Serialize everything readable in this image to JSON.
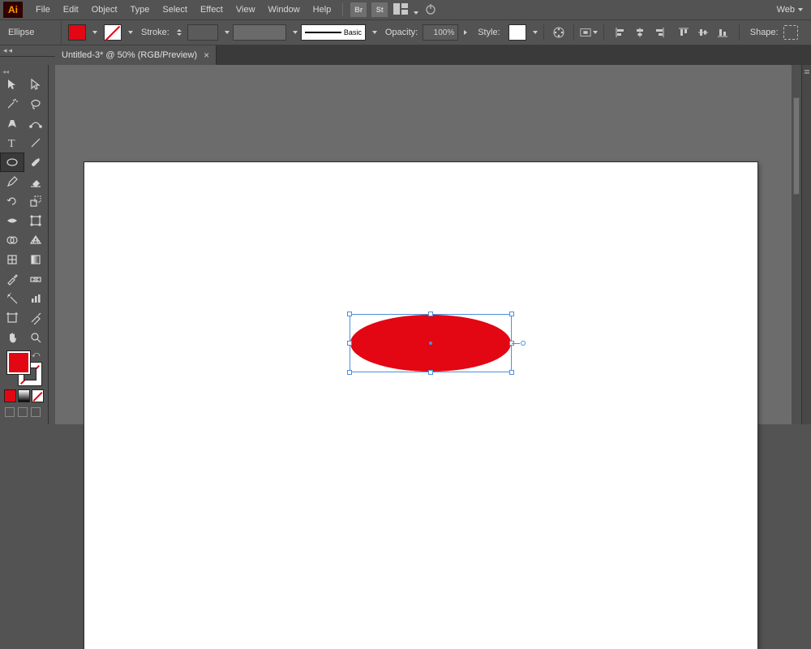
{
  "app_logo": "Ai",
  "menus": [
    "File",
    "Edit",
    "Object",
    "Type",
    "Select",
    "Effect",
    "View",
    "Window",
    "Help"
  ],
  "bridge_label": "Br",
  "stock_label": "St",
  "workspace_name": "Web",
  "control": {
    "selection_label": "Ellipse",
    "fill_color": "#e30613",
    "stroke_label": "Stroke:",
    "stroke_weight": "",
    "profile_label": "Basic",
    "opacity_label": "Opacity:",
    "opacity_value": "100%",
    "style_label": "Style:",
    "shape_label": "Shape:"
  },
  "document": {
    "tab_title": "Untitled-3* @ 50% (RGB/Preview)",
    "zoom": "50%",
    "color_mode": "RGB/Preview"
  },
  "toolbox": {
    "tools": [
      [
        "selection-tool",
        "direct-selection-tool"
      ],
      [
        "magic-wand-tool",
        "lasso-tool"
      ],
      [
        "pen-tool",
        "curvature-tool"
      ],
      [
        "type-tool",
        "line-segment-tool"
      ],
      [
        "ellipse-tool",
        "paintbrush-tool"
      ],
      [
        "pencil-tool",
        "eraser-tool"
      ],
      [
        "rotate-tool",
        "scale-tool"
      ],
      [
        "width-tool",
        "free-transform-tool"
      ],
      [
        "shape-builder-tool",
        "perspective-grid-tool"
      ],
      [
        "mesh-tool",
        "gradient-tool"
      ],
      [
        "eyedropper-tool",
        "blend-tool"
      ],
      [
        "symbol-sprayer-tool",
        "column-graph-tool"
      ],
      [
        "artboard-tool",
        "slice-tool"
      ],
      [
        "hand-tool",
        "zoom-tool"
      ]
    ],
    "active_tool": "ellipse-tool"
  },
  "canvas": {
    "shape_type": "ellipse",
    "shape_fill": "#e30613",
    "selected": true
  }
}
